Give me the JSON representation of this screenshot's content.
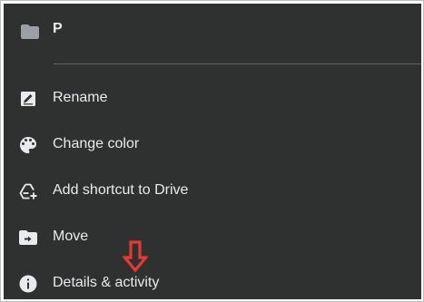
{
  "header": {
    "folder_icon": "folder-icon",
    "folder_name": "P"
  },
  "menu": {
    "items": [
      {
        "label": "Rename",
        "icon": "rename-icon"
      },
      {
        "label": "Change color",
        "icon": "palette-icon"
      },
      {
        "label": "Add shortcut to Drive",
        "icon": "add-shortcut-icon"
      },
      {
        "label": "Move",
        "icon": "move-to-folder-icon"
      },
      {
        "label": "Details & activity",
        "icon": "info-icon"
      }
    ]
  },
  "annotation": {
    "arrow_icon": "down-arrow-icon",
    "arrow_color": "#e53935"
  },
  "colors": {
    "panel_background": "#2f3131",
    "text": "#e8eaed",
    "icon": "#e8eaed",
    "divider": "#5f6368"
  }
}
